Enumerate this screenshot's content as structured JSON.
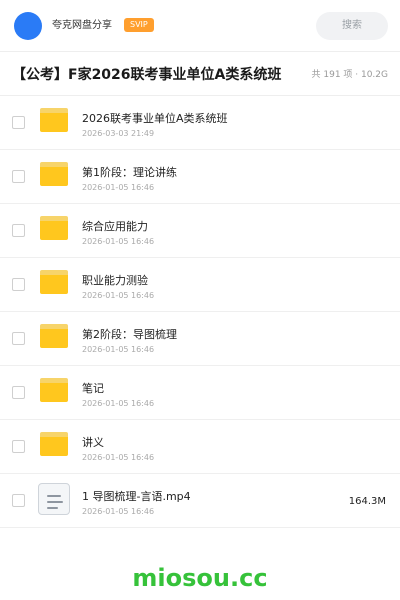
{
  "header": {
    "brand": "夸克网盘分享",
    "badge": "SVIP",
    "search_label": "搜索"
  },
  "share": {
    "title": "【公考】F家2026联考事业单位A类系统班",
    "meta": "共 191 项 · 10.2G"
  },
  "files": [
    {
      "type": "folder",
      "icon": "folder-icon",
      "name": "2026联考事业单位A类系统班",
      "date": "2026-03-03 21:49",
      "size": ""
    },
    {
      "type": "folder",
      "icon": "folder-icon",
      "name": "第1阶段：理论讲练",
      "date": "2026-01-05 16:46",
      "size": ""
    },
    {
      "type": "folder",
      "icon": "folder-icon",
      "name": "综合应用能力",
      "date": "2026-01-05 16:46",
      "size": ""
    },
    {
      "type": "folder",
      "icon": "folder-icon",
      "name": "职业能力测验",
      "date": "2026-01-05 16:46",
      "size": ""
    },
    {
      "type": "folder",
      "icon": "folder-icon",
      "name": "第2阶段：导图梳理",
      "date": "2026-01-05 16:46",
      "size": ""
    },
    {
      "type": "folder",
      "icon": "folder-icon",
      "name": "笔记",
      "date": "2026-01-05 16:46",
      "size": ""
    },
    {
      "type": "folder",
      "icon": "folder-icon",
      "name": "讲义",
      "date": "2026-01-05 16:46",
      "size": ""
    },
    {
      "type": "file",
      "icon": "document-icon",
      "name": "1 导图梳理-言语.mp4",
      "date": "2026-01-05 16:46",
      "size": "164.3M"
    }
  ],
  "watermark": "miosou.cc",
  "colors": {
    "accent_blue": "#2a7bf6",
    "svip_orange": "#ff9f2e",
    "folder_yellow": "#ffc71e",
    "watermark_green": "#36c23a"
  }
}
